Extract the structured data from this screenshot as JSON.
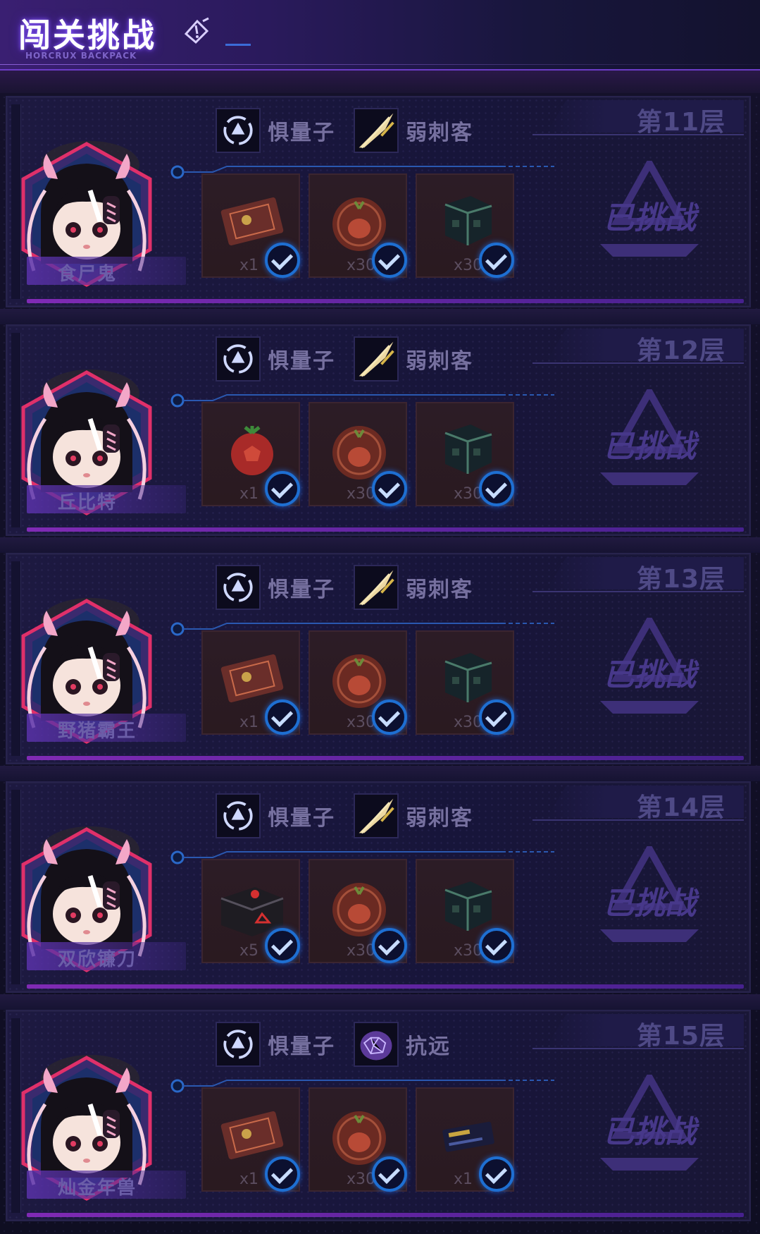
{
  "header": {
    "title": "闯关挑战",
    "subtitle": "HORCRUX BACKPACK"
  },
  "levels": [
    {
      "floor": "第11层",
      "boss": "食尸鬼",
      "enemies": [
        {
          "label": "惧量子",
          "icon": "quantum-icon"
        },
        {
          "label": "弱刺客",
          "icon": "blade-icon"
        }
      ],
      "rewards": [
        {
          "qty": "x1",
          "icon": "ticket-icon"
        },
        {
          "qty": "x30",
          "icon": "fruit-coin-icon"
        },
        {
          "qty": "x30",
          "icon": "cube-icon"
        }
      ],
      "status": "已挑战"
    },
    {
      "floor": "第12层",
      "boss": "丘比特",
      "enemies": [
        {
          "label": "惧量子",
          "icon": "quantum-icon"
        },
        {
          "label": "弱刺客",
          "icon": "blade-icon"
        }
      ],
      "rewards": [
        {
          "qty": "x1",
          "icon": "fruit-icon"
        },
        {
          "qty": "x30",
          "icon": "fruit-coin-icon"
        },
        {
          "qty": "x30",
          "icon": "cube-icon"
        }
      ],
      "status": "已挑战"
    },
    {
      "floor": "第13层",
      "boss": "野猪霸王",
      "enemies": [
        {
          "label": "惧量子",
          "icon": "quantum-icon"
        },
        {
          "label": "弱刺客",
          "icon": "blade-icon"
        }
      ],
      "rewards": [
        {
          "qty": "x1",
          "icon": "ticket-icon"
        },
        {
          "qty": "x30",
          "icon": "fruit-coin-icon"
        },
        {
          "qty": "x30",
          "icon": "cube-icon"
        }
      ],
      "status": "已挑战"
    },
    {
      "floor": "第14层",
      "boss": "双欣镰刀",
      "enemies": [
        {
          "label": "惧量子",
          "icon": "quantum-icon"
        },
        {
          "label": "弱刺客",
          "icon": "blade-icon"
        }
      ],
      "rewards": [
        {
          "qty": "x5",
          "icon": "mech-box-icon"
        },
        {
          "qty": "x30",
          "icon": "fruit-coin-icon"
        },
        {
          "qty": "x30",
          "icon": "cube-icon"
        }
      ],
      "status": "已挑战"
    },
    {
      "floor": "第15层",
      "boss": "灿金年兽",
      "enemies": [
        {
          "label": "惧量子",
          "icon": "quantum-icon"
        },
        {
          "label": "抗远",
          "icon": "shell-icon"
        }
      ],
      "rewards": [
        {
          "qty": "x1",
          "icon": "ticket-icon"
        },
        {
          "qty": "x30",
          "icon": "fruit-coin-icon"
        },
        {
          "qty": "x1",
          "icon": "card-icon"
        }
      ],
      "status": "已挑战"
    }
  ],
  "colors": {
    "accent": "#6c3cc7",
    "check": "#1e6fd2",
    "reward_bg": "#2c1c26"
  }
}
